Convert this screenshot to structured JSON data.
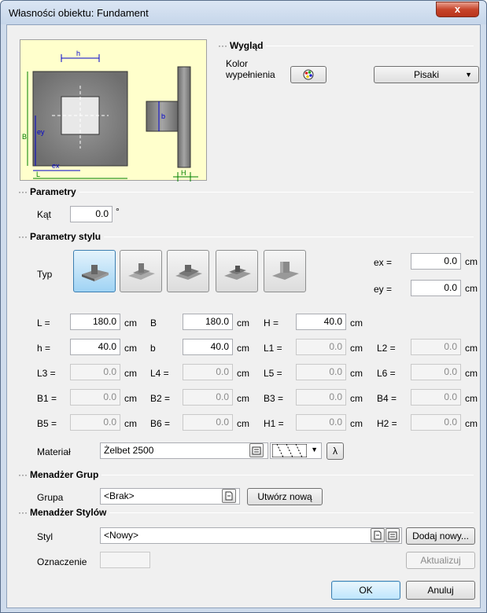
{
  "window": {
    "title": "Własności obiektu: Fundament",
    "close_glyph": "x"
  },
  "wyglad": {
    "title": "Wygląd",
    "fill_color_label_1": "Kolor",
    "fill_color_label_2": "wypełnienia",
    "pens_dropdown": "Pisaki"
  },
  "diagram_labels": {
    "h": "h",
    "b": "b",
    "B": "B",
    "ey": "ey",
    "ex": "ex",
    "L": "L",
    "H": "H"
  },
  "parametry": {
    "title": "Parametry",
    "angle_label": "Kąt",
    "angle_value": "0.0",
    "angle_unit": "°"
  },
  "styl": {
    "title": "Parametry stylu",
    "typ_label": "Typ",
    "ex_label": "ex  =",
    "ex_value": "0.0",
    "ex_unit": "cm",
    "ey_label": "ey  =",
    "ey_value": "0.0",
    "ey_unit": "cm",
    "rows": [
      [
        {
          "label": "L =",
          "value": "180.0",
          "unit": "cm"
        },
        {
          "label": "B",
          "value": "180.0",
          "unit": "cm"
        },
        {
          "label": "H =",
          "value": "40.0",
          "unit": "cm"
        }
      ],
      [
        {
          "label": "h =",
          "value": "40.0",
          "unit": "cm"
        },
        {
          "label": "b",
          "value": "40.0",
          "unit": "cm"
        },
        {
          "label": "L1 =",
          "value": "0.0",
          "unit": "cm"
        },
        {
          "label": "L2 =",
          "value": "0.0",
          "unit": "cm"
        }
      ],
      [
        {
          "label": "L3 =",
          "value": "0.0",
          "unit": "cm"
        },
        {
          "label": "L4 =",
          "value": "0.0",
          "unit": "cm"
        },
        {
          "label": "L5 =",
          "value": "0.0",
          "unit": "cm"
        },
        {
          "label": "L6 =",
          "value": "0.0",
          "unit": "cm"
        }
      ],
      [
        {
          "label": "B1 =",
          "value": "0.0",
          "unit": "cm"
        },
        {
          "label": "B2 =",
          "value": "0.0",
          "unit": "cm"
        },
        {
          "label": "B3 =",
          "value": "0.0",
          "unit": "cm"
        },
        {
          "label": "B4 =",
          "value": "0.0",
          "unit": "cm"
        }
      ],
      [
        {
          "label": "B5 =",
          "value": "0.0",
          "unit": "cm"
        },
        {
          "label": "B6 =",
          "value": "0.0",
          "unit": "cm"
        },
        {
          "label": "H1 =",
          "value": "0.0",
          "unit": "cm"
        },
        {
          "label": "H2 =",
          "value": "0.0",
          "unit": "cm"
        }
      ]
    ],
    "material_label": "Materiał",
    "material_value": "Żelbet 2500",
    "lambda": "λ"
  },
  "grupy": {
    "title": "Menadżer Grup",
    "label": "Grupa",
    "value": "<Brak>",
    "create_button": "Utwórz nową"
  },
  "style_mgr": {
    "title": "Menadżer Stylów",
    "style_label": "Styl",
    "style_value": "<Nowy>",
    "add_button": "Dodaj nowy...",
    "mark_label": "Oznaczenie",
    "mark_value": "",
    "update_button": "Aktualizuj"
  },
  "footer": {
    "ok": "OK",
    "cancel": "Anuluj"
  },
  "colors": {
    "preview_bg": "#ffffcc",
    "accent_blue": "#3c7fb1",
    "dim_blue": "#0000cc",
    "dim_green": "#008000"
  }
}
